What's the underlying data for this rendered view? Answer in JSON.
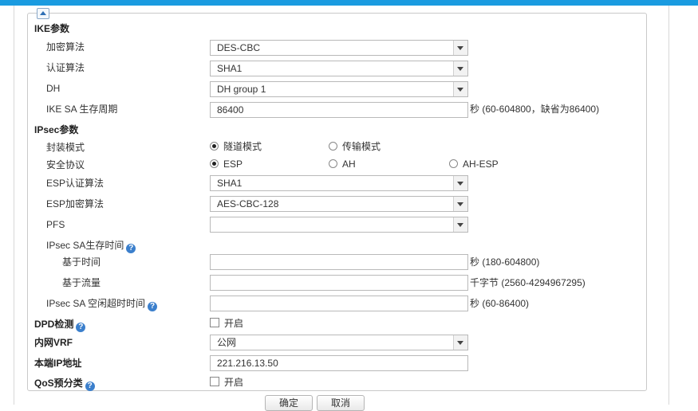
{
  "ike": {
    "title": "IKE参数",
    "encryption": {
      "label": "加密算法",
      "value": "DES-CBC"
    },
    "auth": {
      "label": "认证算法",
      "value": "SHA1"
    },
    "dh": {
      "label": "DH",
      "value": "DH group 1"
    },
    "lifetime": {
      "label": "IKE SA 生存周期",
      "value": "86400",
      "hint": "秒 (60-604800，缺省为86400)"
    }
  },
  "ipsec": {
    "title": "IPsec参数",
    "encap": {
      "label": "封装模式",
      "options": [
        "隧道模式",
        "传输模式"
      ],
      "selected": "隧道模式"
    },
    "protocol": {
      "label": "安全协议",
      "options": [
        "ESP",
        "AH",
        "AH-ESP"
      ],
      "selected": "ESP"
    },
    "esp_auth": {
      "label": "ESP认证算法",
      "value": "SHA1"
    },
    "esp_enc": {
      "label": "ESP加密算法",
      "value": "AES-CBC-128"
    },
    "pfs": {
      "label": "PFS",
      "value": ""
    },
    "sa_lifetime": {
      "label": "IPsec SA生存时间",
      "time": {
        "label": "基于时间",
        "value": "",
        "hint": "秒 (180-604800)"
      },
      "traffic": {
        "label": "基于流量",
        "value": "",
        "hint": "千字节 (2560-4294967295)"
      }
    },
    "idle_timeout": {
      "label": "IPsec SA 空闲超时时间",
      "value": "",
      "hint": "秒 (60-86400)"
    }
  },
  "dpd": {
    "label": "DPD检测",
    "checkbox_label": "开启",
    "checked": false
  },
  "vrf": {
    "label": "内网VRF",
    "value": "公网"
  },
  "local_ip": {
    "label": "本端IP地址",
    "value": "221.216.13.50"
  },
  "qos": {
    "label": "QoS预分类",
    "checkbox_label": "开启",
    "checked": false
  },
  "help_glyph": "?",
  "buttons": {
    "ok": "确定",
    "cancel": "取消"
  },
  "colors": {
    "accent_bar": "#1a9be0",
    "help_icon": "#3b7fcc"
  }
}
